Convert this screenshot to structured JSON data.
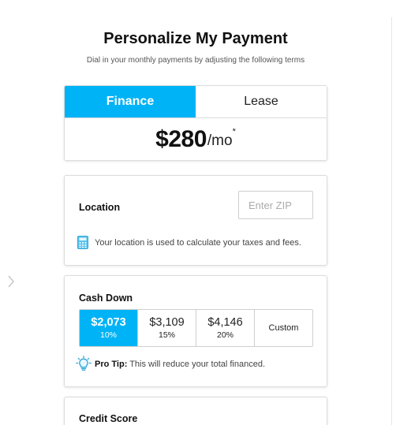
{
  "header": {
    "title": "Personalize My Payment",
    "subtitle": "Dial in your monthly payments by adjusting the following terms"
  },
  "payment": {
    "tabs": [
      {
        "label": "Finance",
        "active": true
      },
      {
        "label": "Lease",
        "active": false
      }
    ],
    "amount": "$280",
    "period": "/mo",
    "asterisk": "*"
  },
  "location": {
    "label": "Location",
    "zip_placeholder": "Enter ZIP",
    "zip_value": "",
    "note": "Your location is used to calculate your taxes and fees.",
    "note_icon": "calculator-icon"
  },
  "cash_down": {
    "label": "Cash Down",
    "options": [
      {
        "amount": "$2,073",
        "percent": "10%",
        "selected": true
      },
      {
        "amount": "$3,109",
        "percent": "15%",
        "selected": false
      },
      {
        "amount": "$4,146",
        "percent": "20%",
        "selected": false
      }
    ],
    "custom_label": "Custom",
    "tip_label": "Pro Tip:",
    "tip_text": " This will reduce your total financed.",
    "tip_icon": "lightbulb-icon"
  },
  "credit_score": {
    "label": "Credit Score"
  },
  "colors": {
    "accent": "#00b3f6",
    "border": "#dcdcdc",
    "text": "#111111"
  }
}
